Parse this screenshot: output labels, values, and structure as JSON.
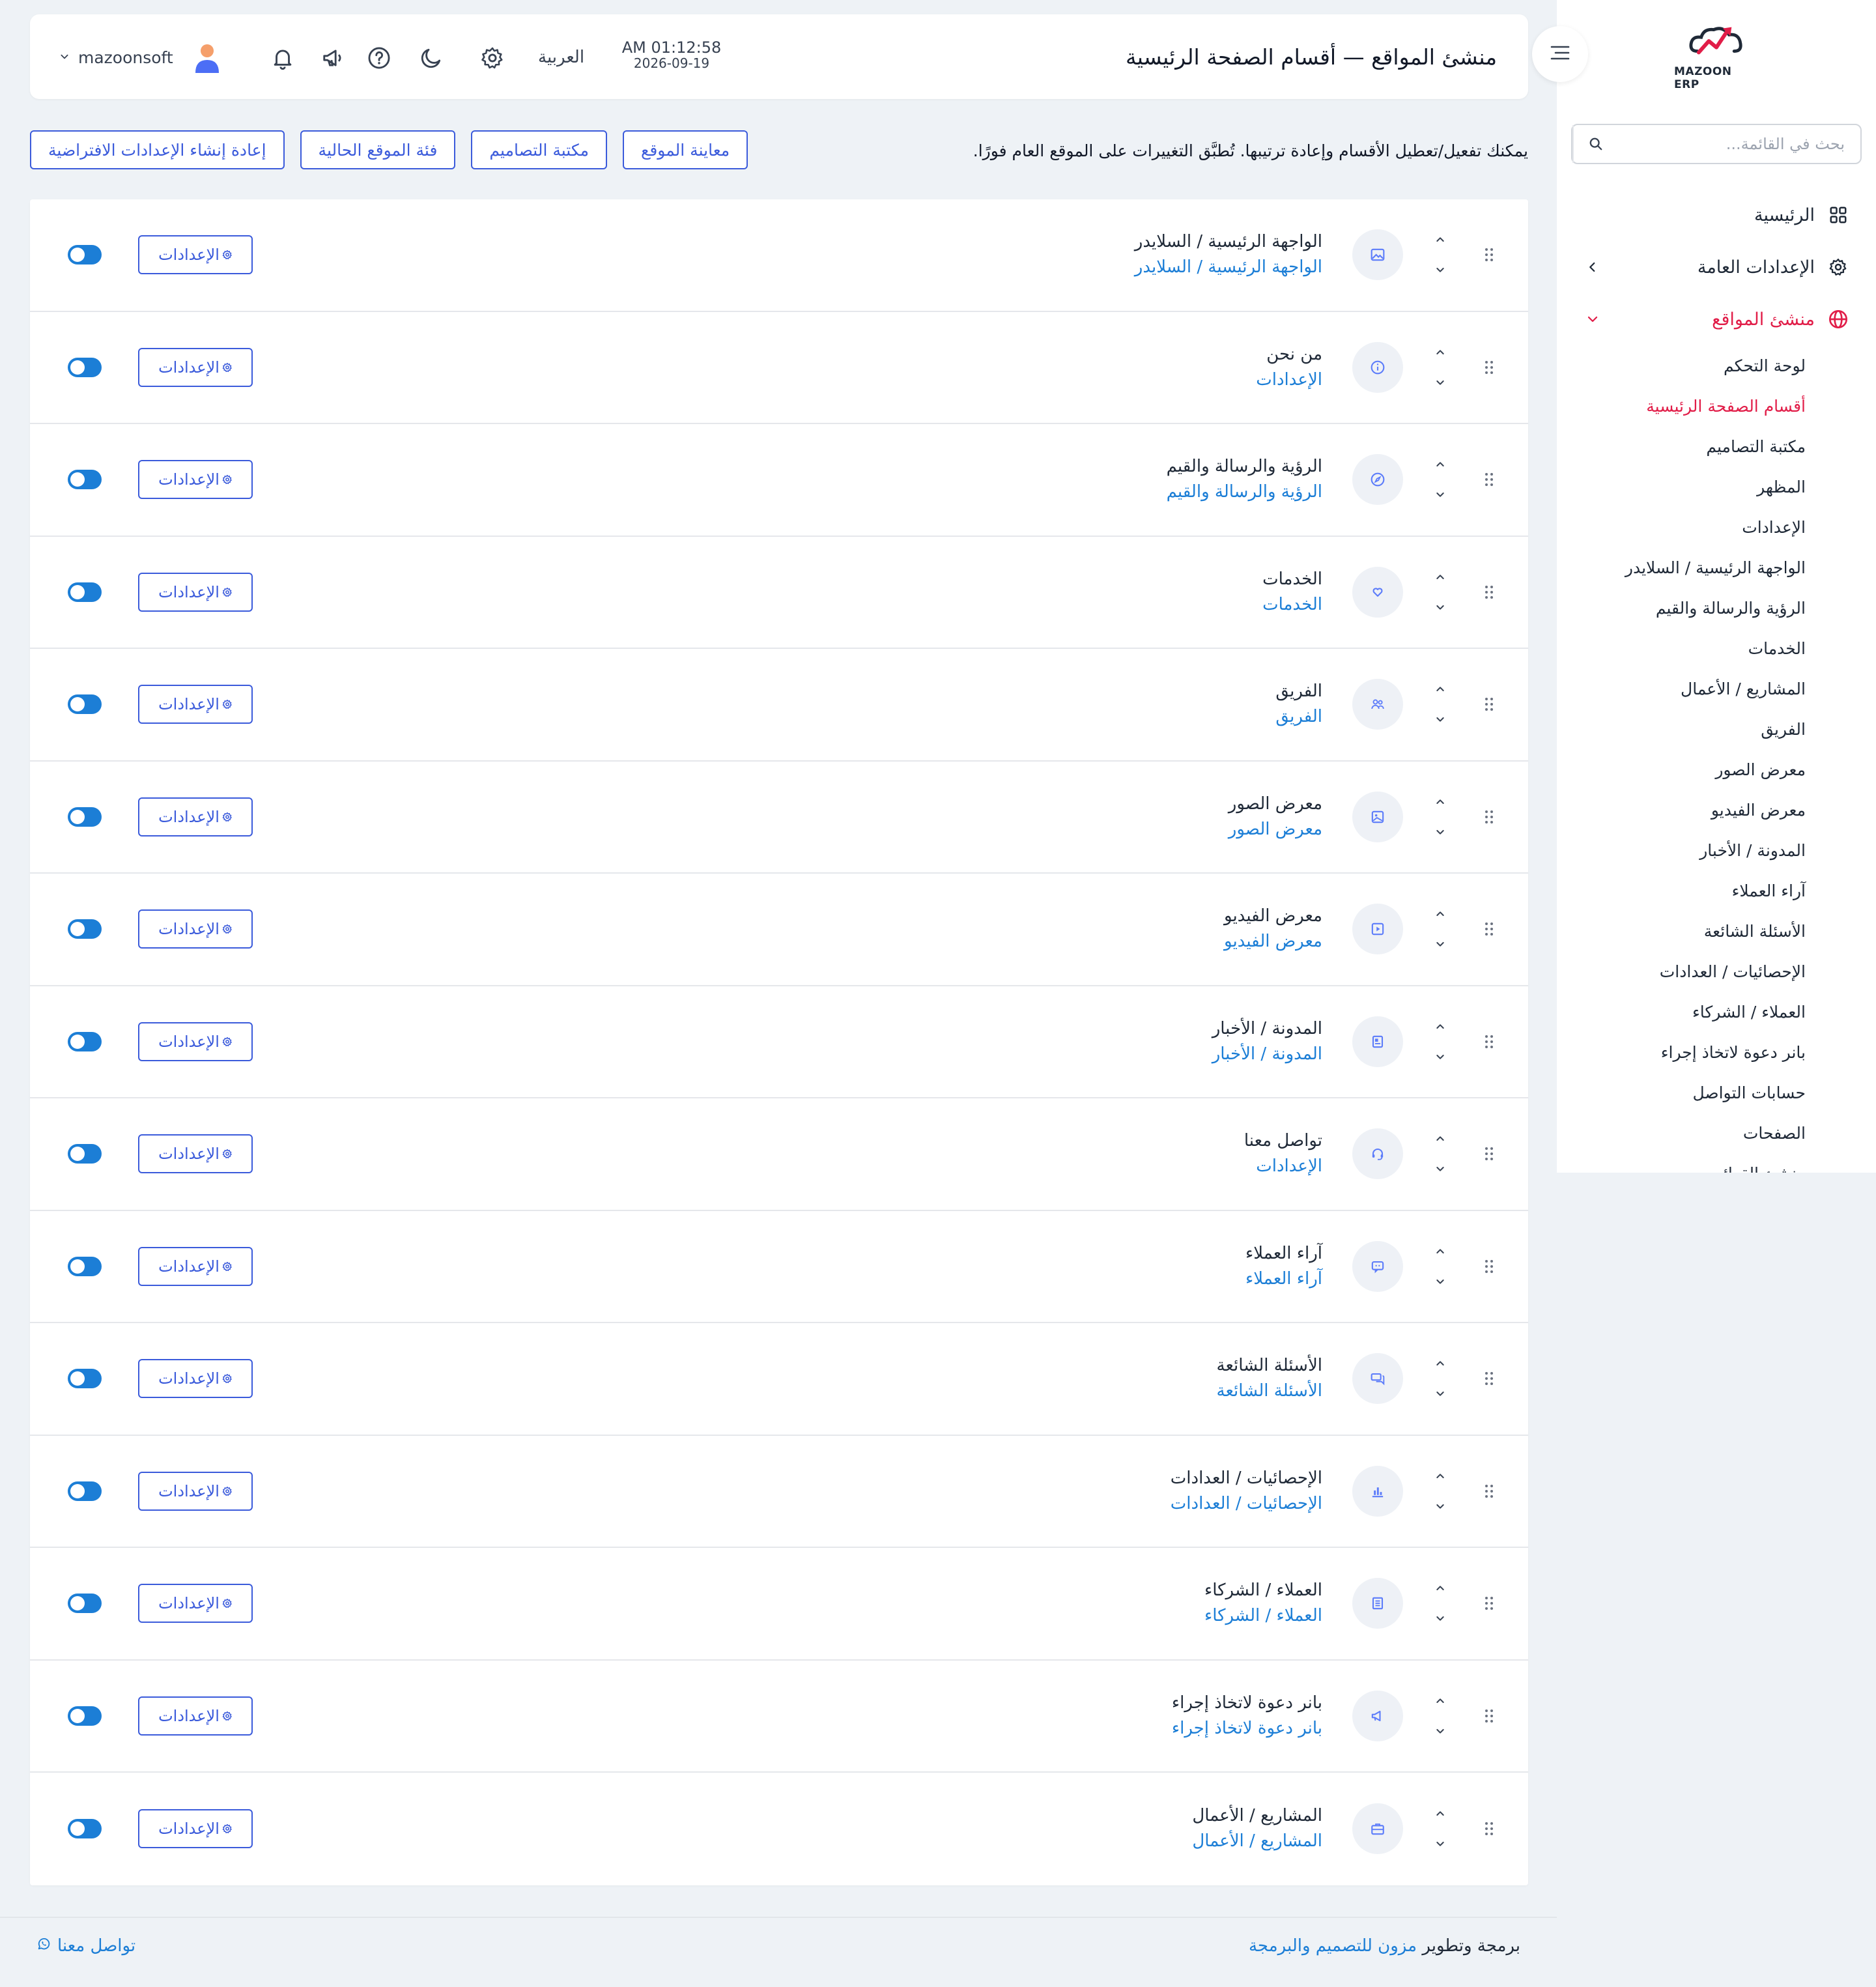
{
  "colors": {
    "accent": "#3b5bdb",
    "link": "#1c7ed6",
    "active": "#e11d48",
    "toggle_on": "#1c7ed6"
  },
  "sidebar": {
    "logo_text": "MAZOON ERP",
    "search_placeholder": "بحث في القائمة...",
    "menu": [
      {
        "label": "الرئيسية",
        "icon": "grid-icon"
      },
      {
        "label": "الإعدادات العامة",
        "icon": "gear-icon"
      },
      {
        "label": "منشئ المواقع",
        "icon": "globe-icon"
      }
    ],
    "submenu": [
      "لوحة التحكم",
      "أقسام الصفحة الرئيسية",
      "مكتبة التصاميم",
      "المظهر",
      "الإعدادات",
      "الواجهة الرئيسية / السلايدر",
      "الرؤية والرسالة والقيم",
      "الخدمات",
      "المشاريع / الأعمال",
      "الفريق",
      "معرض الصور",
      "معرض الفيديو",
      "المدونة / الأخبار",
      "آراء العملاء",
      "الأسئلة الشائعة",
      "الإحصائيات / العدادات",
      "العملاء / الشركاء",
      "بانر دعوة لاتخاذ إجراء",
      "حسابات التواصل",
      "الصفحات",
      "منشئ القوائم"
    ]
  },
  "topbar": {
    "title": "منشئ المواقع — أقسام الصفحة الرئيسية",
    "time": "AM 01:12:58",
    "date": "2026-09-19",
    "language": "العربية",
    "username": "mazoonsoft"
  },
  "toolbar": {
    "intro": "يمكنك تفعيل/تعطيل الأقسام وإعادة ترتيبها. تُطبَّق التغييرات على الموقع العام فورًا.",
    "preview": "معاينة الموقع",
    "library": "مكتبة التصاميم",
    "category": "فئة الموقع الحالية",
    "reset": "إعادة إنشاء الإعدادات الافتراضية"
  },
  "settings_label": "الإعدادات",
  "sections": [
    {
      "title": "الواجهة الرئيسية / السلايدر",
      "sub": "الواجهة الرئيسية / السلايدر",
      "icon": "image-icon",
      "enabled": true
    },
    {
      "title": "من نحن",
      "sub": "الإعدادات",
      "icon": "info-icon",
      "enabled": true
    },
    {
      "title": "الرؤية والرسالة والقيم",
      "sub": "الرؤية والرسالة والقيم",
      "icon": "compass-icon",
      "enabled": true
    },
    {
      "title": "الخدمات",
      "sub": "الخدمات",
      "icon": "heart-hand-icon",
      "enabled": true
    },
    {
      "title": "الفريق",
      "sub": "الفريق",
      "icon": "users-icon",
      "enabled": true
    },
    {
      "title": "معرض الصور",
      "sub": "معرض الصور",
      "icon": "photos-icon",
      "enabled": true
    },
    {
      "title": "معرض الفيديو",
      "sub": "معرض الفيديو",
      "icon": "video-icon",
      "enabled": true
    },
    {
      "title": "المدونة / الأخبار",
      "sub": "المدونة / الأخبار",
      "icon": "news-icon",
      "enabled": true
    },
    {
      "title": "تواصل معنا",
      "sub": "الإعدادات",
      "icon": "headset-icon",
      "enabled": true
    },
    {
      "title": "آراء العملاء",
      "sub": "آراء العملاء",
      "icon": "quote-icon",
      "enabled": true
    },
    {
      "title": "الأسئلة الشائعة",
      "sub": "الأسئلة الشائعة",
      "icon": "chat-icon",
      "enabled": true
    },
    {
      "title": "الإحصائيات / العدادات",
      "sub": "الإحصائيات / العدادات",
      "icon": "bar-chart-icon",
      "enabled": true
    },
    {
      "title": "العملاء / الشركاء",
      "sub": "العملاء / الشركاء",
      "icon": "building-icon",
      "enabled": true
    },
    {
      "title": "بانر دعوة لاتخاذ إجراء",
      "sub": "بانر دعوة لاتخاذ إجراء",
      "icon": "megaphone-icon",
      "enabled": true
    },
    {
      "title": "المشاريع / الأعمال",
      "sub": "المشاريع / الأعمال",
      "icon": "briefcase-icon",
      "enabled": true
    }
  ],
  "footer": {
    "credit_prefix": "برمجة وتطوير",
    "credit_link": "مزون للتصميم والبرمجة",
    "contact": "تواصل معنا"
  }
}
